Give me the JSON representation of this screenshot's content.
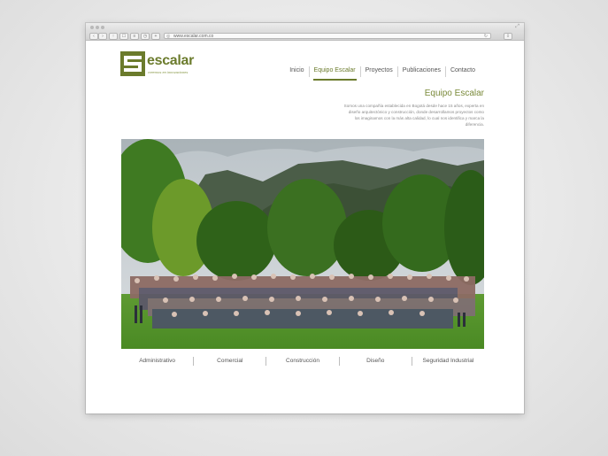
{
  "browser": {
    "url": "www.escalar.com.co"
  },
  "site": {
    "logo_word": "escalar",
    "logo_tagline": "creemos en innovaciones",
    "brand_color": "#6b7b2c"
  },
  "nav": {
    "items": [
      {
        "label": "Inicio",
        "active": false
      },
      {
        "label": "Equipo Escalar",
        "active": true
      },
      {
        "label": "Proyectos",
        "active": false
      },
      {
        "label": "Publicaciones",
        "active": false
      },
      {
        "label": "Contacto",
        "active": false
      }
    ]
  },
  "section": {
    "title": "Equipo Escalar",
    "intro": "Somos una compañía establecida en Bogotá desde hace 15 años, experta en diseño arquitectónico y construcción, donde desarrollamos proyectos como los imaginamos con la más alta calidad, lo cual nos identifica y marca la diferencia."
  },
  "categories": [
    "Administrativo",
    "Comercial",
    "Construcción",
    "Diseño",
    "Seguridad Industrial"
  ]
}
